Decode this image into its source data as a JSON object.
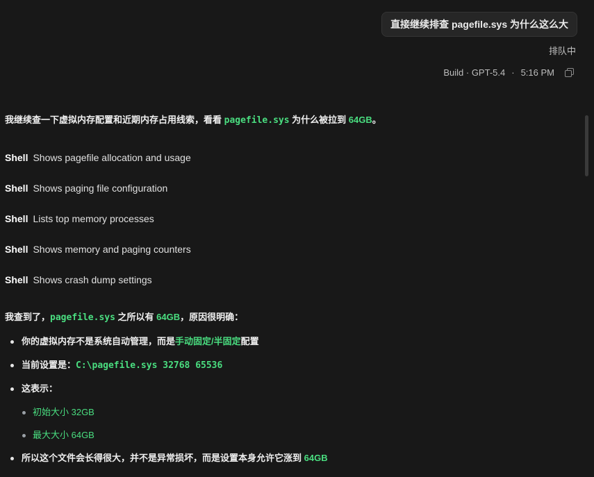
{
  "user_message": "直接继续排查 pagefile.sys 为什么这么大",
  "queue_status": "排队中",
  "meta": {
    "model": "Build · GPT-5.4",
    "separator": "·",
    "time": "5:16 PM",
    "copy_icon": "copy-icon"
  },
  "intro": {
    "before": "我继续查一下虚拟内存配置和近期内存占用线索，看看 ",
    "code": "pagefile.sys",
    "middle": " 为什么被拉到 ",
    "size": "64GB",
    "after": "。"
  },
  "shell_calls": [
    {
      "label": "Shell",
      "desc": "Shows pagefile allocation and usage"
    },
    {
      "label": "Shell",
      "desc": "Shows paging file configuration"
    },
    {
      "label": "Shell",
      "desc": "Lists top memory processes"
    },
    {
      "label": "Shell",
      "desc": "Shows memory and paging counters"
    },
    {
      "label": "Shell",
      "desc": "Shows crash dump settings"
    }
  ],
  "finding": {
    "before": "我查到了，",
    "code": "pagefile.sys",
    "middle": " 之所以有 ",
    "size": "64GB",
    "after": "，原因很明确："
  },
  "bullets": {
    "b1_before": "你的虚拟内存不是系统自动管理，而是",
    "b1_highlight": "手动固定/半固定",
    "b1_after": "配置",
    "b2_before": "当前设置是：",
    "b2_code": "C:\\pagefile.sys 32768 65536",
    "b3": "这表示：",
    "b3_sub1": "初始大小 32GB",
    "b3_sub2": "最大大小 64GB",
    "b4_before": "所以这个文件会长得很大，并不是异常损坏，而是设置本身允许它涨到 ",
    "b4_size": "64GB"
  }
}
